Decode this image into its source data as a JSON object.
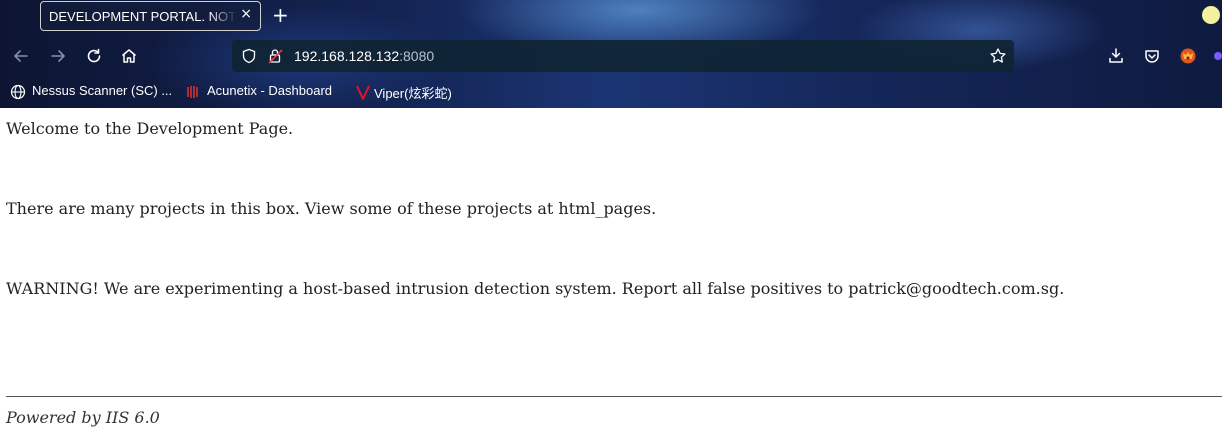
{
  "browser": {
    "tab_title": "DEVELOPMENT PORTAL. NOT FOR OUTSIDERS OR HACKERS!",
    "tab_close": "×",
    "new_tab": "+",
    "url_host": "192.168.128.132",
    "url_port": ":8080",
    "bookmarks": [
      {
        "label": "Nessus Scanner (SC) ...",
        "icon": "globe-icon"
      },
      {
        "label": "Acunetix - Dashboard",
        "icon": "acunetix-icon"
      },
      {
        "label": "Viper(炫彩蛇)",
        "icon": "viper-icon"
      }
    ]
  },
  "page": {
    "welcome": "Welcome to the Development Page.",
    "projects": "There are many projects in this box. View some of these projects at html_pages.",
    "warning": "WARNING! We are experimenting a host-based intrusion detection system. Report all false positives to patrick@goodtech.com.sg.",
    "footer": "Powered by IIS 6.0"
  },
  "colors": {
    "accent_viper": "#e0142b",
    "text": "#222222"
  }
}
